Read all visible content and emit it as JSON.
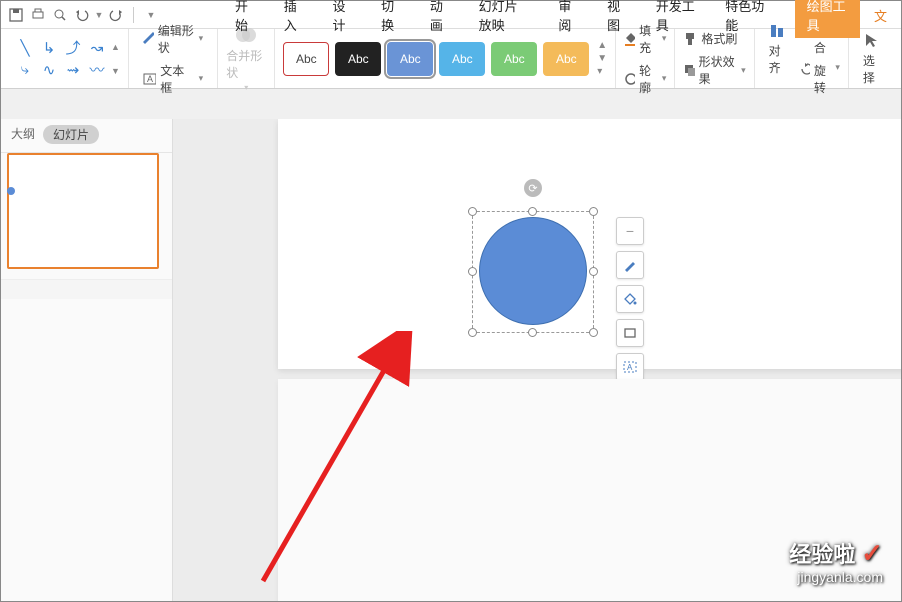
{
  "toolbar_top_icons": [
    "save",
    "print",
    "print-preview",
    "undo",
    "redo"
  ],
  "menu": {
    "start": "开始",
    "insert": "插入",
    "design": "设计",
    "transition": "切换",
    "animation": "动画",
    "slideshow": "幻灯片放映",
    "review": "审阅",
    "view": "视图",
    "developer": "开发工具",
    "special": "特色功能",
    "drawing_tools": "绘图工具",
    "text_partial": "文"
  },
  "ribbon": {
    "edit_shape": "编辑形状",
    "text_box": "文本框",
    "merge_shapes": "合并形状",
    "style_label": "Abc",
    "fill": "填充",
    "format_painter": "格式刷",
    "outline": "轮廓",
    "shape_effect": "形状效果",
    "combine": "组合",
    "align": "对齐",
    "rotate": "旋转",
    "select": "选择",
    "colors": {
      "white": "#ffffff",
      "black": "#222222",
      "blue": "#5b8cd6",
      "sky": "#55b4e8",
      "green": "#7bcb76",
      "orange": "#f4bb5a"
    }
  },
  "sidebar": {
    "outline": "大纲",
    "slides": "幻灯片"
  },
  "watermark": {
    "name": "经验啦",
    "url": "jingyanla.com"
  }
}
